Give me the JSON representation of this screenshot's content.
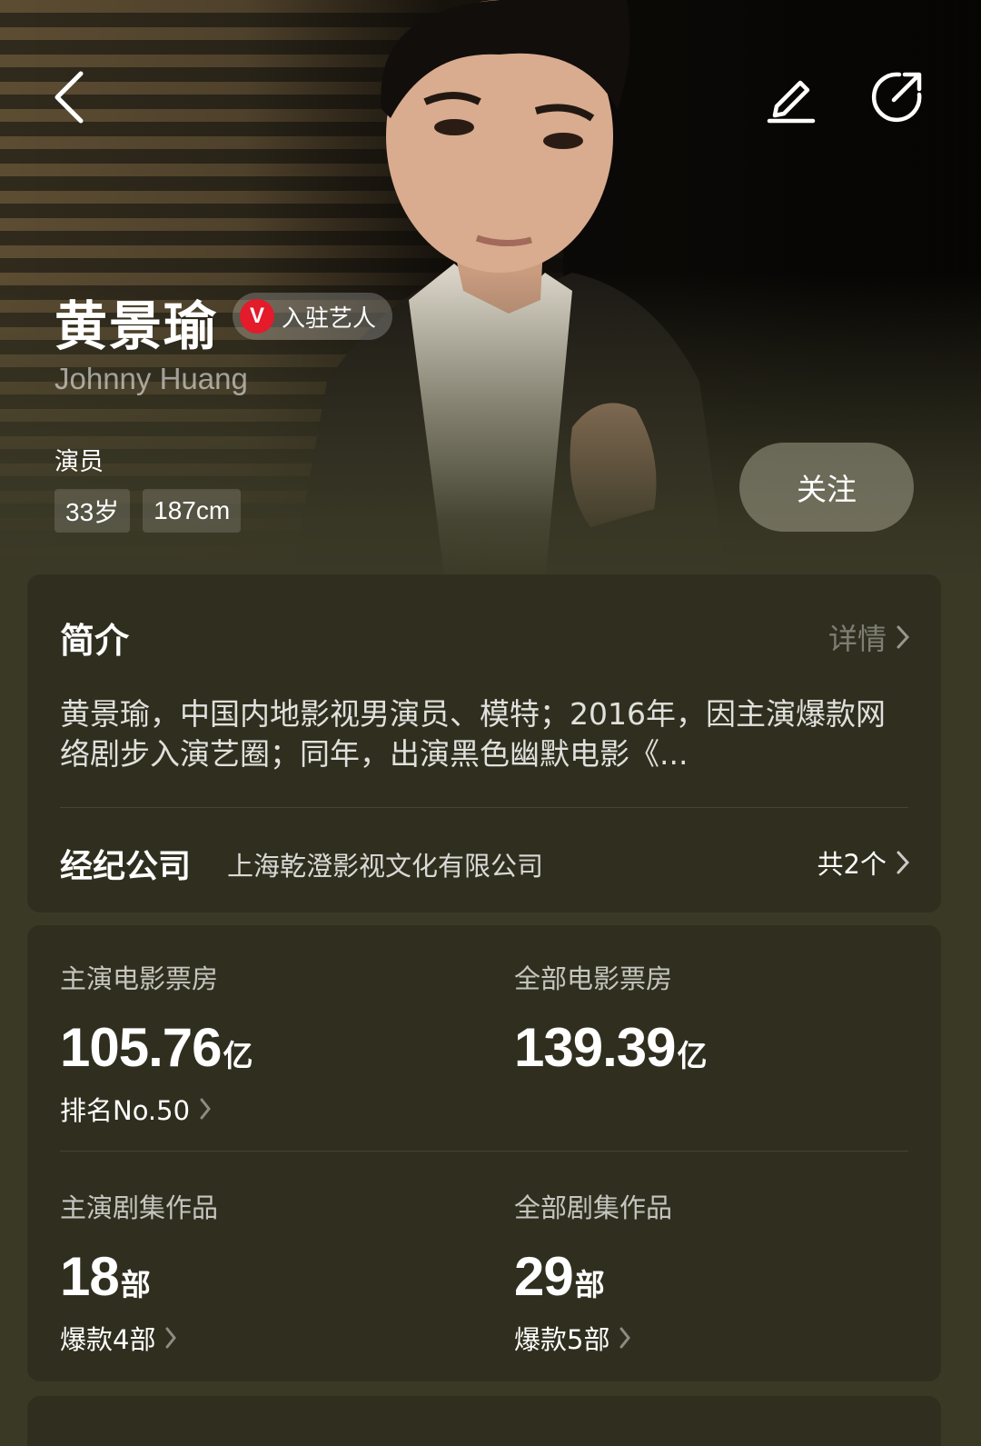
{
  "profile": {
    "name": "黄景瑜",
    "badge_mark": "V",
    "badge_label": "入驻艺人",
    "english_name": "Johnny Huang",
    "profession": "演员",
    "tags": [
      "33岁",
      "187cm"
    ],
    "follow_label": "关注"
  },
  "intro": {
    "title": "简介",
    "detail_label": "详情",
    "text": "黄景瑜，中国内地影视男演员、模特；2016年，因主演爆款网络剧步入演艺圈；同年，出演黑色幽默电影《...",
    "agency_label": "经纪公司",
    "agency_value": "上海乾澄影视文化有限公司",
    "agency_count": "共2个"
  },
  "stats": [
    {
      "label": "主演电影票房",
      "number": "105.76",
      "unit": "亿",
      "sub": "排名No.50"
    },
    {
      "label": "全部电影票房",
      "number": "139.39",
      "unit": "亿",
      "sub": ""
    },
    {
      "label": "主演剧集作品",
      "number": "18",
      "unit": "部",
      "sub": "爆款4部"
    },
    {
      "label": "全部剧集作品",
      "number": "29",
      "unit": "部",
      "sub": "爆款5部"
    }
  ],
  "icons": {
    "back": "back-arrow-icon",
    "edit": "edit-pencil-icon",
    "share": "share-icon",
    "chevron": "chevron-right-icon"
  },
  "colors": {
    "background": "#3a3926",
    "card": "#302f1f",
    "verified": "#e31b2a"
  }
}
